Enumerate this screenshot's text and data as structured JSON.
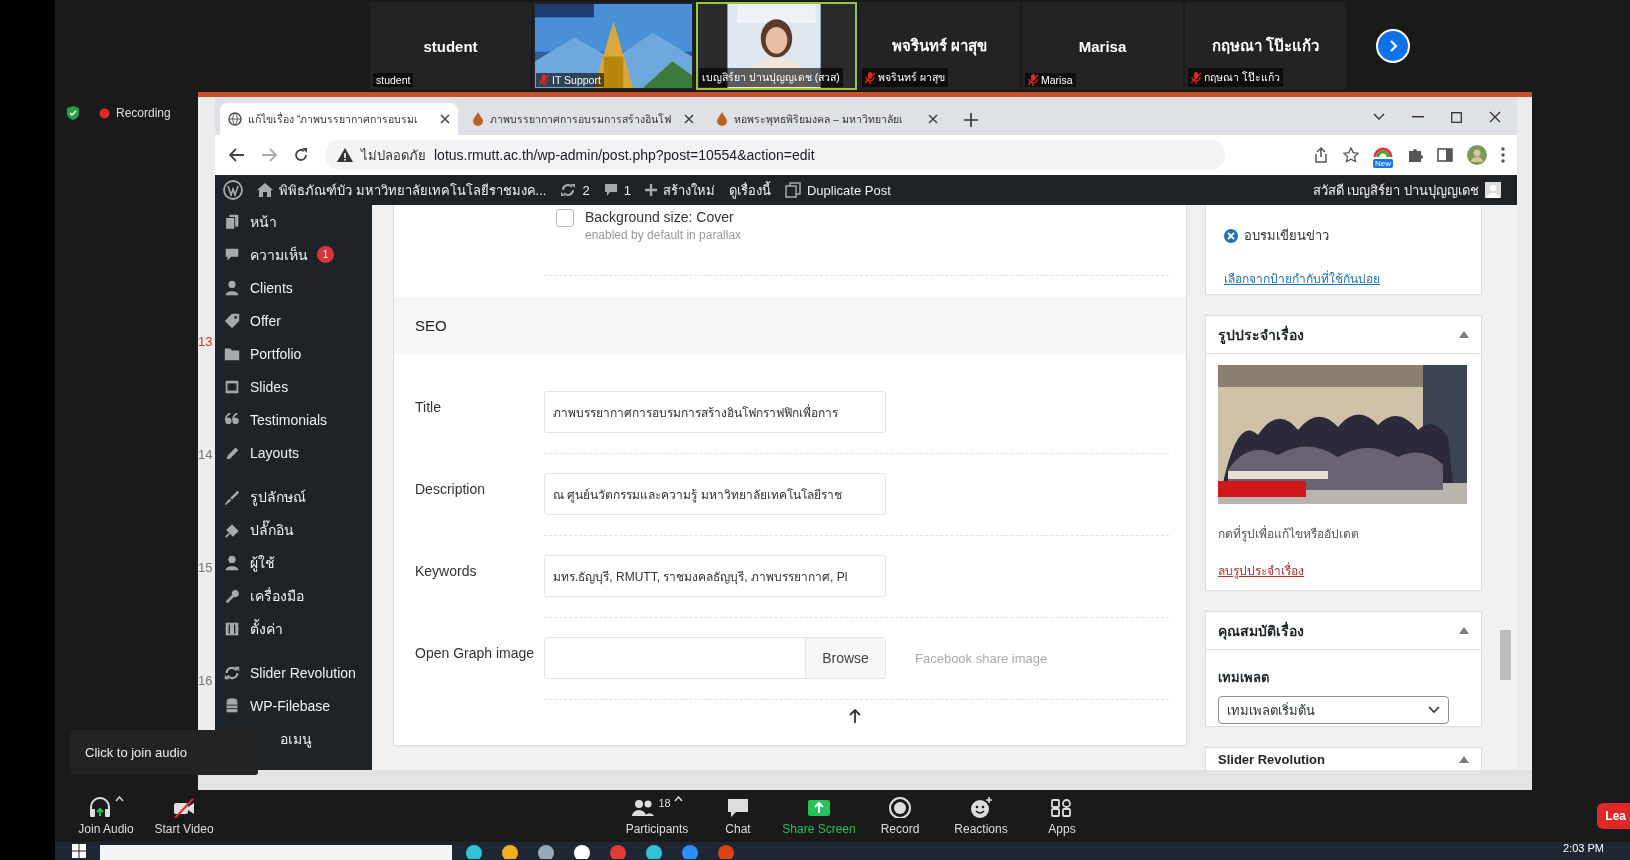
{
  "meeting": {
    "participants": [
      {
        "kind": "name",
        "name": "student",
        "label": "student",
        "muted": false,
        "active": false
      },
      {
        "kind": "picture",
        "label": "IT Support",
        "muted": true,
        "active": false
      },
      {
        "kind": "person",
        "label": "เบญสิร์ยา ปานปุญญเดช (สวส)",
        "muted": false,
        "active": true
      },
      {
        "kind": "name",
        "name": "พจรินทร์ ผาสุข",
        "label": "พจรินทร์ ผาสุข",
        "muted": true,
        "active": false
      },
      {
        "kind": "name",
        "name": "Marisa",
        "label": "Marisa",
        "muted": true,
        "active": false
      },
      {
        "kind": "name",
        "name": "กฤษณา โป๊ะแก้ว",
        "label": "กฤษณา โป๊ะแก้ว",
        "muted": true,
        "active": false
      }
    ],
    "recording": "Recording",
    "audio_tooltip": "Click to join audio",
    "toolbar": [
      {
        "kind": "audio",
        "label": "Join Audio",
        "caret": true
      },
      {
        "kind": "video",
        "label": "Start Video",
        "caret": false
      },
      {
        "kind": "participants",
        "label": "Participants",
        "count": "18",
        "caret": true
      },
      {
        "kind": "chat",
        "label": "Chat",
        "caret": false
      },
      {
        "kind": "share",
        "label": "Share Screen",
        "caret": false
      },
      {
        "kind": "record",
        "label": "Record",
        "caret": false
      },
      {
        "kind": "reactions",
        "label": "Reactions",
        "caret": false
      },
      {
        "kind": "apps",
        "label": "Apps",
        "caret": false
      }
    ],
    "leave_button": "Lea"
  },
  "document": {
    "line_numbers": [
      {
        "text": "13",
        "highlighted": true
      },
      {
        "text": "14",
        "highlighted": false
      },
      {
        "text": "15",
        "highlighted": false
      },
      {
        "text": "16",
        "highlighted": false
      }
    ]
  },
  "browser": {
    "tabs": [
      {
        "title": "แก้ไขเรื่อง “ภาพบรรยากาศการอบรมเ",
        "selected": true
      },
      {
        "title": "ภาพบรรยากาศการอบรมการสร้างอินโฟ",
        "selected": false
      },
      {
        "title": "หอพระพุทธพิริยมงคล – มหาวิทยาลัยเ",
        "selected": false
      }
    ],
    "address": {
      "security": "ไม่ปลอดภัย",
      "url": "lotus.rmutt.ac.th/wp-admin/post.php?post=10554&action=edit"
    },
    "extension_badge": "New"
  },
  "admin_bar": {
    "site": "พิพิธภัณฑ์บัว มหาวิทยาลัยเทคโนโลยีราชมงค...",
    "updates": "2",
    "comments": "1",
    "new": "สร้างใหม่",
    "view": "ดูเรื่องนี้",
    "duplicate": "Duplicate Post",
    "greeting": "สวัสดี เบญสิร์ยา ปานปุญญเดช"
  },
  "sidebar": {
    "groups": [
      [
        {
          "label": "หน้า"
        },
        {
          "label": "ความเห็น",
          "badge": "1"
        },
        {
          "label": "Clients"
        },
        {
          "label": "Offer"
        },
        {
          "label": "Portfolio"
        },
        {
          "label": "Slides"
        },
        {
          "label": "Testimonials"
        },
        {
          "label": "Layouts"
        }
      ],
      [
        {
          "label": "รูปลักษณ์"
        },
        {
          "label": "ปลั๊กอิน"
        },
        {
          "label": "ผู้ใช้"
        },
        {
          "label": "เครื่องมือ"
        },
        {
          "label": "ตั้งค่า"
        }
      ],
      [
        {
          "label": "Slider Revolution"
        },
        {
          "label": "WP-Filebase"
        },
        {
          "label": "อเมนู",
          "kind": "collapse"
        }
      ]
    ]
  },
  "editor": {
    "checkbox": {
      "label": "Background size: Cover",
      "hint": "enabled by default in parallax",
      "checked": false
    },
    "section": "SEO",
    "fields": [
      {
        "kind": "text",
        "label": "Title",
        "value": "ภาพบรรยากาศการอบรมการสร้างอินโฟกราฟฟิกเพื่อการ"
      },
      {
        "kind": "text",
        "label": "Description",
        "value": "ณ ศูนย์นวัตกรรมและความรู้ มหาวิทยาลัยเทคโนโลยีราช"
      },
      {
        "kind": "text",
        "label": "Keywords",
        "value": "มทร.ธัญบุรี, RMUTT, ราชมงคลธัญบุรี, ภาพบรรยากาศ, Pl"
      },
      {
        "kind": "file",
        "label": "Open Graph image",
        "button": "Browse",
        "hint": "Facebook share image"
      }
    ]
  },
  "side_boxes": [
    {
      "kind": "tags",
      "tags": [
        {
          "label": "อบรมเขียนข่าว"
        }
      ],
      "link": "เลือกจากป้ายกำกับที่ใช้กันบ่อย"
    },
    {
      "kind": "featured_image",
      "title": "รูปประจำเรื่อง",
      "expanded": true,
      "caption": "กดที่รูปเพื่อแก้ไขหรืออัปเดต",
      "remove_link": "ลบรูปประจำเรื่อง"
    },
    {
      "kind": "attributes",
      "title": "คุณสมบัติเรื่อง",
      "expanded": true,
      "field_label": "เทมเพลต",
      "value": "เทมเพลตเริ่มต้น"
    },
    {
      "kind": "header_only",
      "title": "Slider Revolution",
      "expanded": true
    }
  ],
  "taskbar": {
    "clock": "2:03 PM"
  }
}
